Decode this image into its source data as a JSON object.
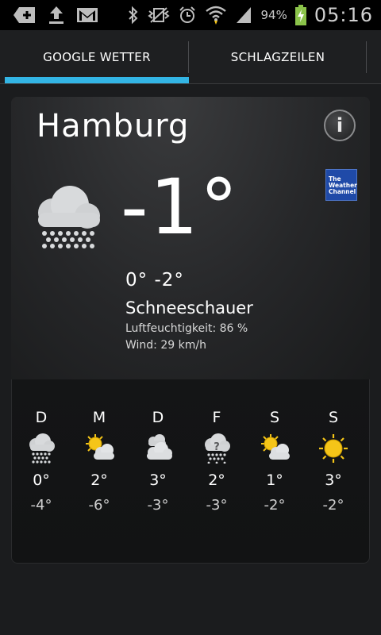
{
  "status_bar": {
    "battery_percent": "94%",
    "time": "05:16",
    "icons": [
      "add-notification-icon",
      "upload-icon",
      "gmail-icon",
      "bluetooth-icon",
      "vibrate-icon",
      "alarm-icon",
      "wifi-icon",
      "signal-icon",
      "battery-charging-icon"
    ]
  },
  "tabs": [
    {
      "label": "GOOGLE WETTER",
      "selected": true
    },
    {
      "label": "SCHLAGZEILEN",
      "selected": false
    }
  ],
  "colors": {
    "accent": "#33b5e5",
    "background": "#1b1c1e",
    "sun": "#f5c518"
  },
  "current": {
    "city": "Hamburg",
    "temperature": "-1°",
    "high_low": "0° -2°",
    "condition": "Schneeschauer",
    "humidity": "Luftfeuchtigkeit: 86 %",
    "wind": "Wind: 29 km/h",
    "icon": "snow-showers-icon",
    "info_icon": "info-icon",
    "provider_logo": "The Weather Channel"
  },
  "forecast": [
    {
      "day": "D",
      "icon": "snow-icon",
      "high": "0°",
      "low": "-4°"
    },
    {
      "day": "M",
      "icon": "partly-sunny-icon",
      "high": "2°",
      "low": "-6°"
    },
    {
      "day": "D",
      "icon": "cloudy-icon",
      "high": "3°",
      "low": "-3°"
    },
    {
      "day": "F",
      "icon": "unknown-snow-icon",
      "high": "2°",
      "low": "-3°"
    },
    {
      "day": "S",
      "icon": "partly-sunny-icon",
      "high": "1°",
      "low": "-2°"
    },
    {
      "day": "S",
      "icon": "sunny-icon",
      "high": "3°",
      "low": "-2°"
    }
  ]
}
